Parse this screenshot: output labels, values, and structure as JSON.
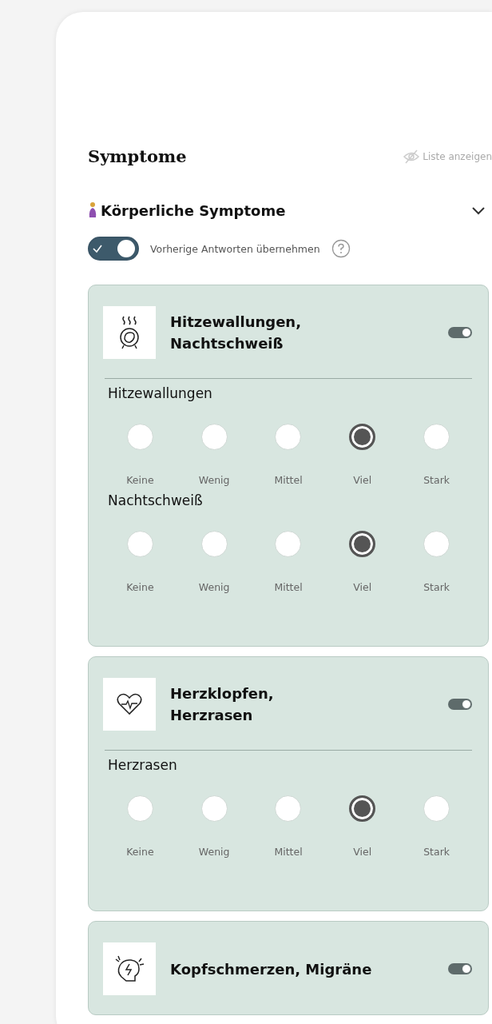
{
  "header": {
    "title": "Symptome",
    "list_link": "Liste anzeigen"
  },
  "section": {
    "title": "Körperliche Symptome",
    "expanded": true
  },
  "carry_over": {
    "label": "Vorherige Antworten übernehmen",
    "on": true
  },
  "cards": [
    {
      "kind": "hot",
      "title": "Hitzewallungen,\nNachtschweiß",
      "on": true,
      "questions": [
        {
          "label": "Hitzewallungen",
          "options": [
            {
              "label": "Keine",
              "selected": false
            },
            {
              "label": "Wenig",
              "selected": false
            },
            {
              "label": "Mittel",
              "selected": false
            },
            {
              "label": "Viel",
              "selected": true
            },
            {
              "label": "Stark",
              "selected": false
            }
          ]
        },
        {
          "label": "Nachtschweiß",
          "options": [
            {
              "label": "Keine",
              "selected": false
            },
            {
              "label": "Wenig",
              "selected": false
            },
            {
              "label": "Mittel",
              "selected": false
            },
            {
              "label": "Viel",
              "selected": true
            },
            {
              "label": "Stark",
              "selected": false
            }
          ]
        }
      ]
    },
    {
      "kind": "heart",
      "title": "Herzklopfen,\nHerzrasen",
      "on": true,
      "questions": [
        {
          "label": "Herzrasen",
          "options": [
            {
              "label": "Keine",
              "selected": false
            },
            {
              "label": "Wenig",
              "selected": false
            },
            {
              "label": "Mittel",
              "selected": false
            },
            {
              "label": "Viel",
              "selected": true
            },
            {
              "label": "Stark",
              "selected": false
            }
          ]
        }
      ]
    },
    {
      "kind": "head",
      "title": "Kopfschmerzen, Migräne",
      "on": true
    }
  ]
}
